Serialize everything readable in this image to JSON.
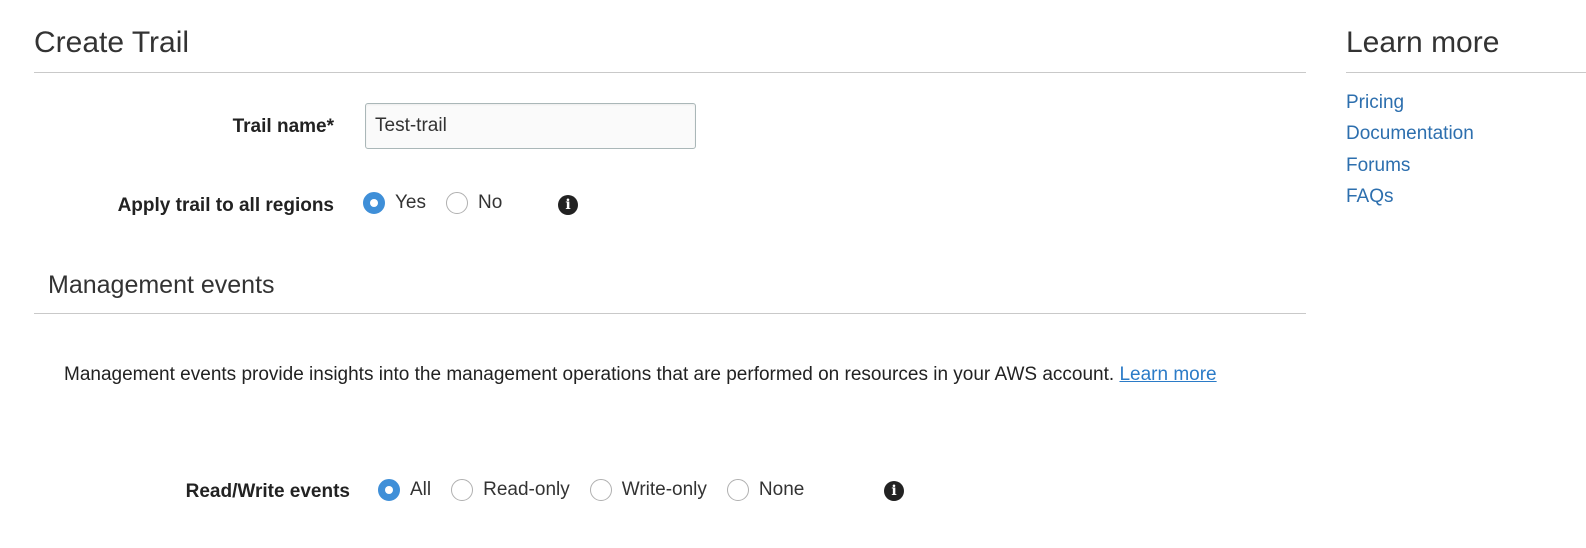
{
  "main": {
    "title": "Create Trail",
    "trail_name": {
      "label": "Trail name*",
      "value": "Test-trail"
    },
    "apply_regions": {
      "label": "Apply trail to all regions",
      "options": [
        "Yes",
        "No"
      ],
      "selected": "Yes",
      "info_icon": "info-icon"
    },
    "management_events": {
      "title": "Management events",
      "description": "Management events provide insights into the management operations that are performed on resources in your AWS account.",
      "learn_more_link": "Learn more",
      "read_write": {
        "label": "Read/Write events",
        "options": [
          "All",
          "Read-only",
          "Write-only",
          "None"
        ],
        "selected": "All",
        "info_icon": "info-icon"
      }
    }
  },
  "sidebar": {
    "title": "Learn more",
    "links": [
      "Pricing",
      "Documentation",
      "Forums",
      "FAQs"
    ]
  },
  "colors": {
    "accent": "#3f8fd8",
    "link": "#2d6fae"
  }
}
